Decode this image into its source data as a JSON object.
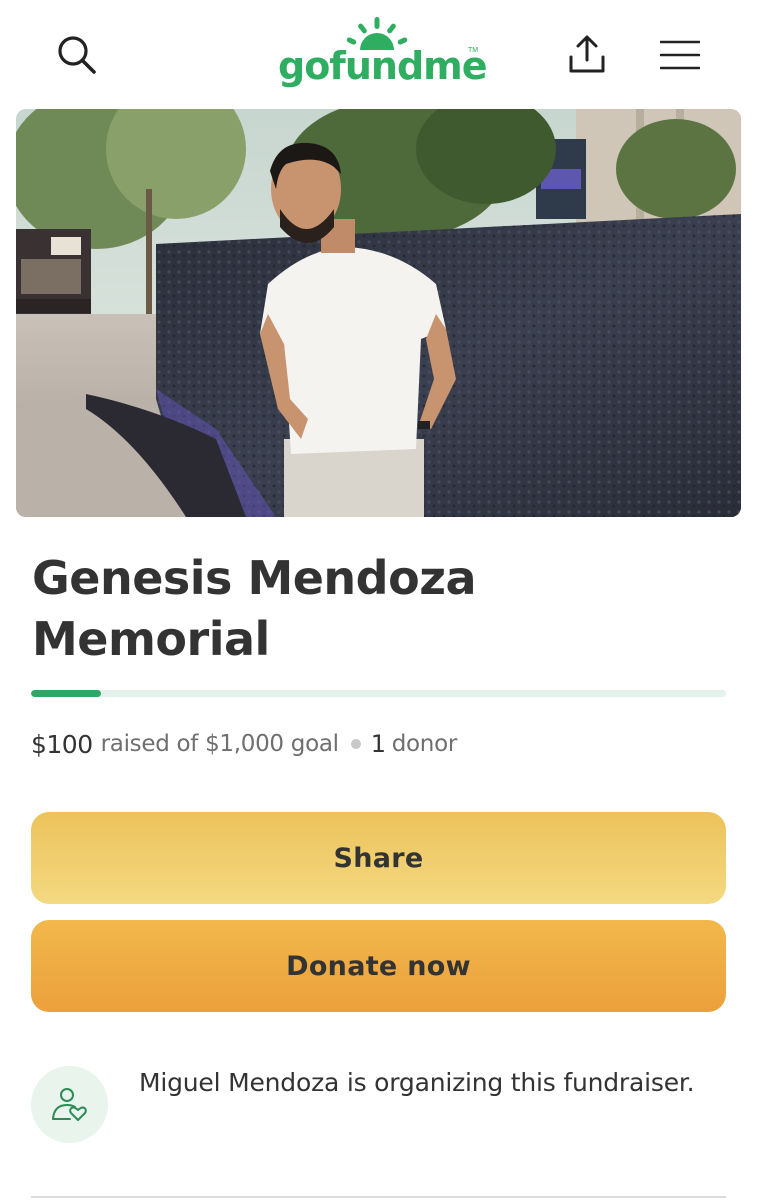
{
  "header": {
    "logo_text": "gofundme",
    "logo_tm": "TM",
    "icons": [
      "search-icon",
      "share-upload-icon",
      "hamburger-menu-icon"
    ],
    "brand_color": "#2fae62"
  },
  "campaign": {
    "title": "Genesis Mendoza Memorial",
    "raised_amount": "$100",
    "raised_text": "raised of $1,000 goal",
    "donor_count": "1",
    "donor_text": "donor",
    "progress_fraction": 0.1,
    "progress_color": "#2ea867"
  },
  "actions": {
    "share_label": "Share",
    "donate_label": "Donate now"
  },
  "organizer": {
    "text": "Miguel Mendoza is organizing this fundraiser.",
    "icon": "person-heart-icon"
  }
}
